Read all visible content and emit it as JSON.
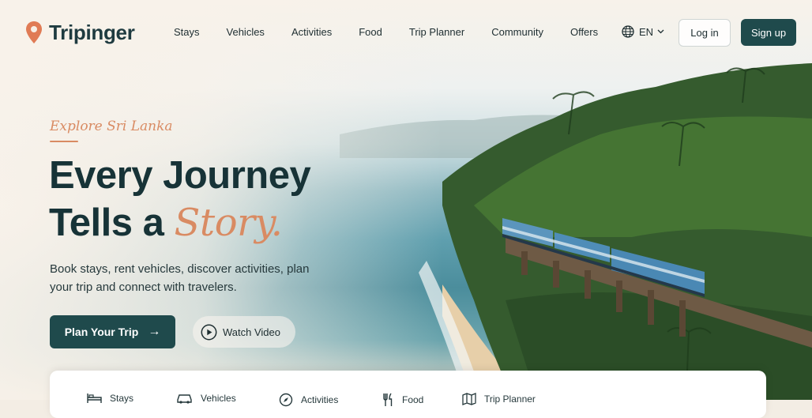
{
  "brand": {
    "name": "Tripinger",
    "accent_color": "#d98b63",
    "primary_color": "#1f4a4c"
  },
  "nav": {
    "items": [
      "Stays",
      "Vehicles",
      "Activities",
      "Food",
      "Trip Planner",
      "Community",
      "Offers"
    ],
    "language": "EN",
    "login_label": "Log in",
    "signup_label": "Sign up"
  },
  "hero": {
    "eyebrow": "Explore Sri Lanka",
    "headline_line1": "Every Journey",
    "headline_line2_prefix": "Tells a",
    "headline_accent": "Story.",
    "subtext": "Book stays, rent vehicles, discover activities, plan your trip and connect with travelers.",
    "primary_cta": "Plan Your Trip",
    "secondary_cta": "Watch Video"
  },
  "search_panel": {
    "tabs": [
      {
        "label": "Stays",
        "icon": "bed-icon"
      },
      {
        "label": "Vehicles",
        "icon": "car-icon"
      },
      {
        "label": "Activities",
        "icon": "compass-icon"
      },
      {
        "label": "Food",
        "icon": "utensils-icon"
      },
      {
        "label": "Trip Planner",
        "icon": "map-icon"
      }
    ]
  }
}
